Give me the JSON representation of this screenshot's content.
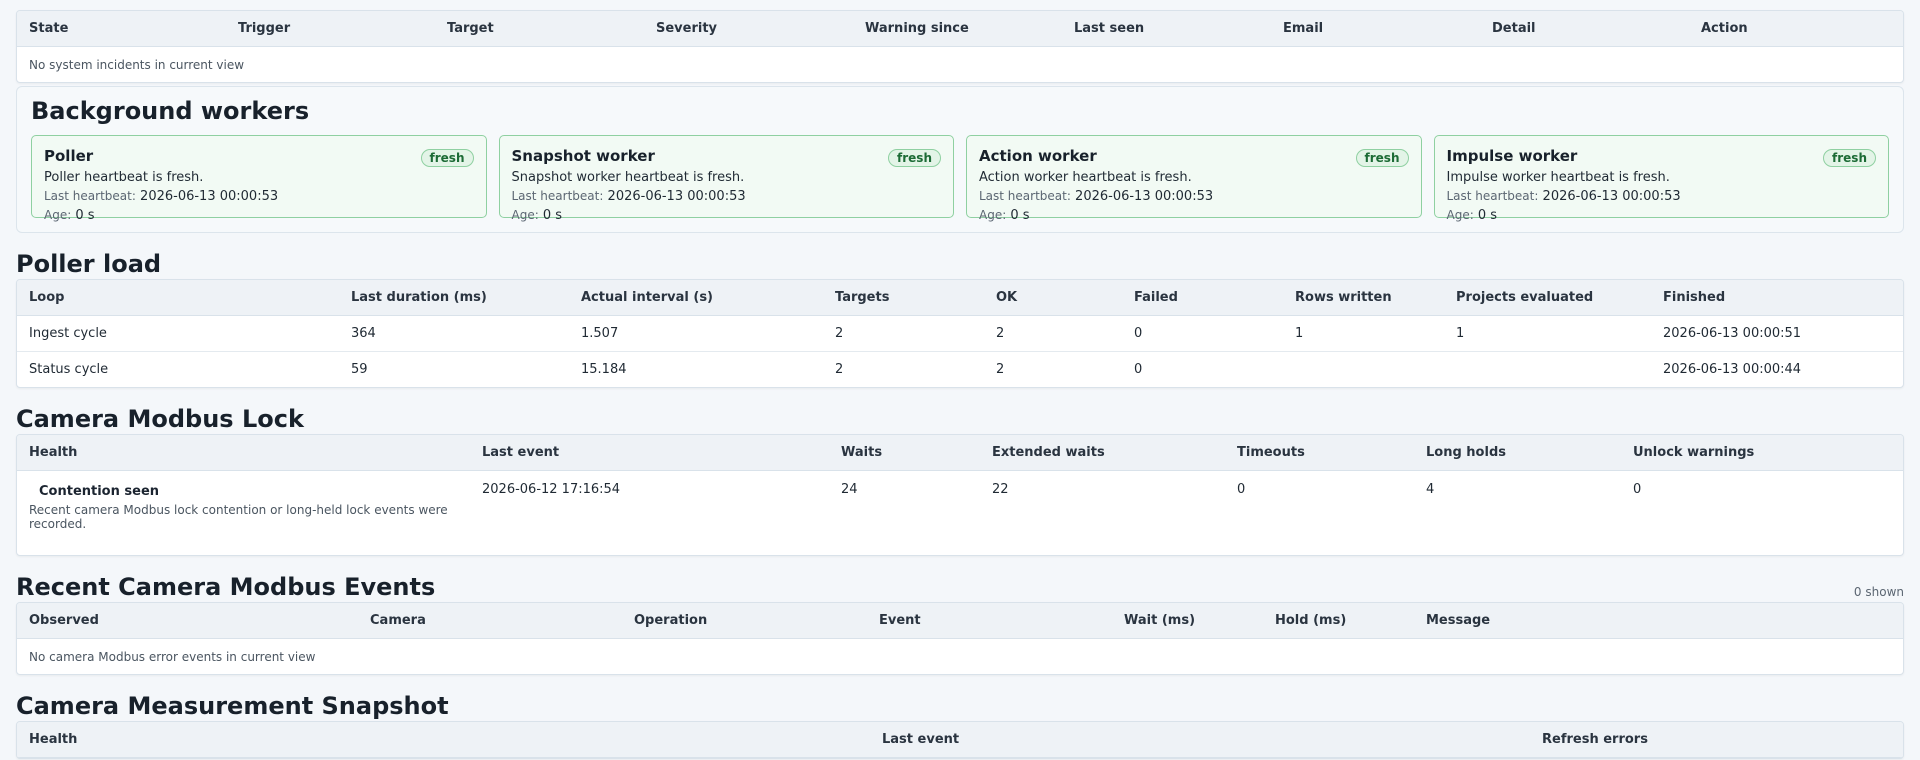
{
  "incidents": {
    "columns": [
      "State",
      "Trigger",
      "Target",
      "Severity",
      "Warning since",
      "Last seen",
      "Email",
      "Detail",
      "Action"
    ],
    "empty_text": "No system incidents in current view"
  },
  "workers": {
    "title": "Background workers",
    "last_heartbeat_label": "Last heartbeat:",
    "age_label": "Age:",
    "items": [
      {
        "name": "Poller",
        "status": "fresh",
        "message": "Poller heartbeat is fresh.",
        "last_heartbeat": "2026-06-13 00:00:53",
        "age": "0 s"
      },
      {
        "name": "Snapshot worker",
        "status": "fresh",
        "message": "Snapshot worker heartbeat is fresh.",
        "last_heartbeat": "2026-06-13 00:00:53",
        "age": "0 s"
      },
      {
        "name": "Action worker",
        "status": "fresh",
        "message": "Action worker heartbeat is fresh.",
        "last_heartbeat": "2026-06-13 00:00:53",
        "age": "0 s"
      },
      {
        "name": "Impulse worker",
        "status": "fresh",
        "message": "Impulse worker heartbeat is fresh.",
        "last_heartbeat": "2026-06-13 00:00:53",
        "age": "0 s"
      }
    ]
  },
  "poller_load": {
    "title": "Poller load",
    "columns": [
      "Loop",
      "Last duration (ms)",
      "Actual interval (s)",
      "Targets",
      "OK",
      "Failed",
      "Rows written",
      "Projects evaluated",
      "Finished"
    ],
    "rows": [
      [
        "Ingest cycle",
        "364",
        "1.507",
        "2",
        "2",
        "0",
        "1",
        "1",
        "2026-06-13 00:00:51"
      ],
      [
        "Status cycle",
        "59",
        "15.184",
        "2",
        "2",
        "0",
        "",
        "",
        "2026-06-13 00:00:44"
      ]
    ]
  },
  "modbus_lock": {
    "title": "Camera Modbus Lock",
    "columns": [
      "Health",
      "Last event",
      "Waits",
      "Extended waits",
      "Timeouts",
      "Long holds",
      "Unlock warnings"
    ],
    "row": {
      "health_title": "Contention seen",
      "health_desc": "Recent camera Modbus lock contention or long-held lock events were recorded.",
      "last_event": "2026-06-12 17:16:54",
      "waits": "24",
      "extended_waits": "22",
      "timeouts": "0",
      "long_holds": "4",
      "unlock_warnings": "0"
    }
  },
  "modbus_events": {
    "title": "Recent Camera Modbus Events",
    "count": "0 shown",
    "columns": [
      "Observed",
      "Camera",
      "Operation",
      "Event",
      "Wait (ms)",
      "Hold (ms)",
      "Message"
    ],
    "empty_text": "No camera Modbus error events in current view"
  },
  "measurement_snapshot": {
    "title": "Camera Measurement Snapshot",
    "columns": [
      "Health",
      "Last event",
      "Refresh errors"
    ]
  }
}
